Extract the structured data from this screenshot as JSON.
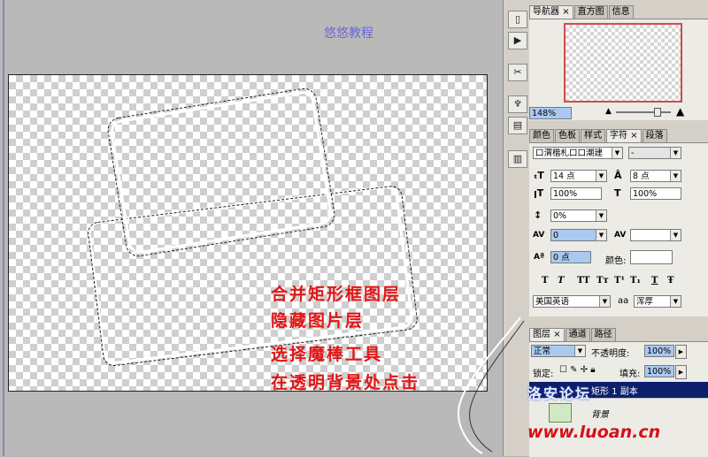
{
  "watermark_top": "悠悠教程",
  "instructions": [
    "合并矩形框图层",
    "隐藏图片层",
    "选择魔棒工具",
    "在透明背景处点击"
  ],
  "toolbar_icons": [
    "history-icon",
    "actions-icon",
    "tools-icon",
    "clone-source-icon",
    "brush-preset-icon",
    "notes-icon"
  ],
  "toolbar_glyphs": [
    "▯",
    "▶",
    "✂",
    "♆",
    "▤",
    "▥"
  ],
  "navigator": {
    "tabs": [
      "导航器",
      "直方图",
      "信息"
    ],
    "zoom": "148%"
  },
  "character": {
    "tabs": [
      "颜色",
      "色板",
      "样式",
      "字符",
      "段落"
    ],
    "font_family": "口渭楷札口口潮建",
    "font_style": "-",
    "size": "14 点",
    "leading": "8 点",
    "vscale": "100%",
    "hscale": "100%",
    "tracking_pct": "0%",
    "kerning": "0",
    "kerning2": "",
    "baseline": "0 点",
    "color_label": "颜色:",
    "style_buttons": [
      "T",
      "T",
      "TT",
      "Tт",
      "T¹",
      "T₁",
      "T",
      "Ŧ"
    ],
    "language": "美国英语",
    "antialias_label": "aa",
    "antialias": "浑厚"
  },
  "layers": {
    "tabs": [
      "图层",
      "通道",
      "路径"
    ],
    "blend_mode": "正常",
    "opacity_label": "不透明度:",
    "opacity": "100%",
    "lock_label": "锁定:",
    "fill_label": "填充:",
    "fill": "100%",
    "layer_name": "矩形 1 副本",
    "layer_name2": "背景"
  },
  "forum_watermark": "洛安论坛",
  "bottom_watermark": "www.luoan.cn",
  "colors": {
    "accent": "#e21515",
    "nav_border": "#d24b4b",
    "field_blue": "#a9c9f0"
  }
}
